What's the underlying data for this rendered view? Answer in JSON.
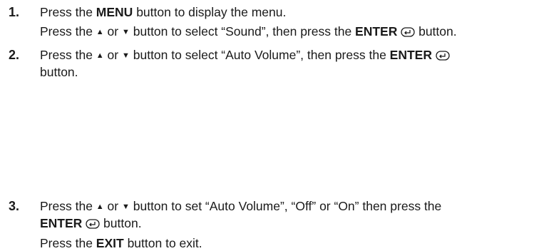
{
  "steps": [
    {
      "number": "1.",
      "lines": [
        {
          "pre": "Press the ",
          "bold": "MENU",
          "post": " button to display the menu."
        },
        {
          "pre": "Press the ",
          "up": "▲",
          "mid": " or ",
          "down": "▼",
          "after_arrows": " button to select “Sound”, then press the ",
          "bold": "ENTER",
          "post": " button."
        }
      ]
    },
    {
      "number": "2.",
      "lines": [
        {
          "pre": "Press the ",
          "up": "▲",
          "mid": " or ",
          "down": "▼",
          "after_arrows": " button to select “Auto Volume”, then press the ",
          "bold": "ENTER"
        },
        {
          "text": "button."
        }
      ]
    },
    {
      "number": "3.",
      "lines": [
        {
          "pre": "Press the ",
          "up": "▲",
          "mid": " or ",
          "down": "▼",
          "after_arrows": " button to set “Auto Volume”, “Off” or “On” then press the"
        },
        {
          "bold": "ENTER",
          "post": " button."
        },
        {
          "pre": "Press the ",
          "bold": "EXIT",
          "post": " button to exit."
        }
      ]
    }
  ],
  "icons": {
    "enter": "enter-icon"
  }
}
